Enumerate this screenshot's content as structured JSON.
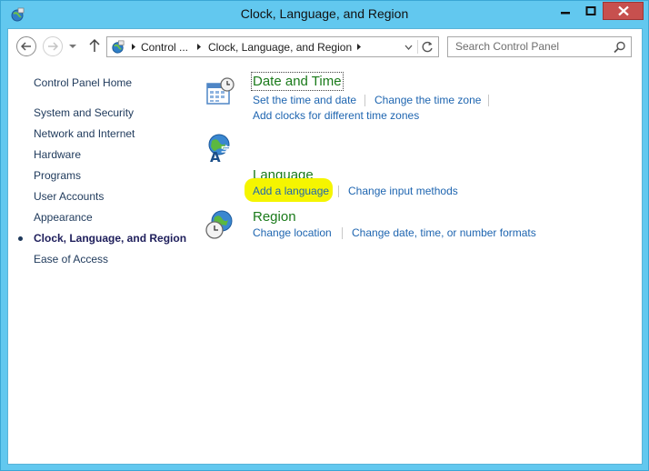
{
  "window": {
    "title": "Clock, Language, and Region",
    "icon": "control-panel-icon",
    "titlebar_color": "#62c8ef",
    "close_color": "#c7504e"
  },
  "nav": {
    "back_icon": "back-arrow-icon",
    "forward_icon": "forward-arrow-icon",
    "recent_icon": "chevron-down-icon",
    "up_icon": "up-arrow-icon"
  },
  "address": {
    "crumbs": [
      "Control ...",
      "Clock, Language, and Region"
    ],
    "icon": "control-panel-icon"
  },
  "search": {
    "placeholder": "Search Control Panel",
    "icon": "search-icon"
  },
  "sidebar": {
    "home": "Control Panel Home",
    "items": [
      {
        "label": "System and Security"
      },
      {
        "label": "Network and Internet"
      },
      {
        "label": "Hardware"
      },
      {
        "label": "Programs"
      },
      {
        "label": "User Accounts"
      },
      {
        "label": "Appearance"
      },
      {
        "label": "Clock, Language, and Region",
        "active": true
      },
      {
        "label": "Ease of Access"
      }
    ]
  },
  "categories": [
    {
      "title": "Date and Time",
      "icon": "calendar-clock-icon",
      "tasks": [
        "Set the time and date",
        "Change the time zone",
        "Add clocks for different time zones"
      ]
    },
    {
      "title": "Language",
      "icon": "language-globe-icon",
      "tasks": [
        "Add a language",
        "Change input methods"
      ]
    },
    {
      "title": "Region",
      "icon": "region-globe-clock-icon",
      "tasks": [
        "Change location",
        "Change date, time, or number formats"
      ]
    }
  ],
  "colors": {
    "category_title": "#1a7a1a",
    "task_link": "#1e65b0",
    "sidebar_link": "#1e395b",
    "highlight": "#f5f500"
  }
}
